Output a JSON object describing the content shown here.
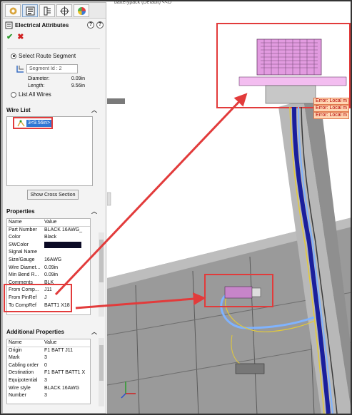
{
  "tabs": [
    {
      "icon": "feature-manager-icon"
    },
    {
      "icon": "property-manager-icon"
    },
    {
      "icon": "configuration-manager-icon"
    },
    {
      "icon": "dimxpert-icon"
    },
    {
      "icon": "display-manager-icon"
    }
  ],
  "panel": {
    "title": "Electrical Attributes",
    "help_labels": [
      "?",
      "?"
    ],
    "ok_glyph": "✔",
    "cancel_glyph": "✖"
  },
  "route": {
    "select_route_label": "Select Route Segment",
    "segment_placeholder": "Segment Id : 2",
    "diameter_label": "Diameter:",
    "diameter_value": "0.09in",
    "length_label": "Length:",
    "length_value": "9.56in",
    "list_all_label": "List All Wires"
  },
  "wire_list": {
    "header": "Wire List",
    "item": "3<9.56in>",
    "show_cross_section": "Show Cross Section"
  },
  "properties": {
    "header": "Properties",
    "col_name": "Name",
    "col_value": "Value",
    "rows": [
      {
        "name": "Part Number",
        "value": "BLACK 16AWG_"
      },
      {
        "name": "Color",
        "value": "Black"
      },
      {
        "name": "SWColor",
        "value": ""
      },
      {
        "name": "Signal Name",
        "value": ""
      },
      {
        "name": "Size/Gauge",
        "value": "16AWG"
      },
      {
        "name": "Wire Diamet...",
        "value": "0.09in"
      },
      {
        "name": "Min Bend R...",
        "value": "0.09in"
      },
      {
        "name": "Comments",
        "value": "BLK"
      },
      {
        "name": "From Comp...",
        "value": "J11"
      },
      {
        "name": "From PinRef",
        "value": "J"
      },
      {
        "name": "To CompRef",
        "value": "BATT1 X18"
      }
    ],
    "swcolor_hex": "#0b0a25"
  },
  "additional": {
    "header": "Additional Properties",
    "col_name": "Name",
    "col_value": "Value",
    "rows": [
      {
        "name": "Origin",
        "value": "F1 BATT J11"
      },
      {
        "name": "Mark",
        "value": "3"
      },
      {
        "name": "Cabling order",
        "value": "0"
      },
      {
        "name": "Destination",
        "value": "F1 BATT BATT1 X"
      },
      {
        "name": "Equipotential",
        "value": "3"
      },
      {
        "name": "Wire style",
        "value": "BLACK 16AWG"
      },
      {
        "name": "Number",
        "value": "3"
      }
    ]
  },
  "viewport": {
    "doc_title": "batterypack (Default) <<D",
    "errors": [
      "Error: Local m",
      "Error: Local m",
      "Error: Local m"
    ],
    "accent_red": "#e23b3b"
  }
}
